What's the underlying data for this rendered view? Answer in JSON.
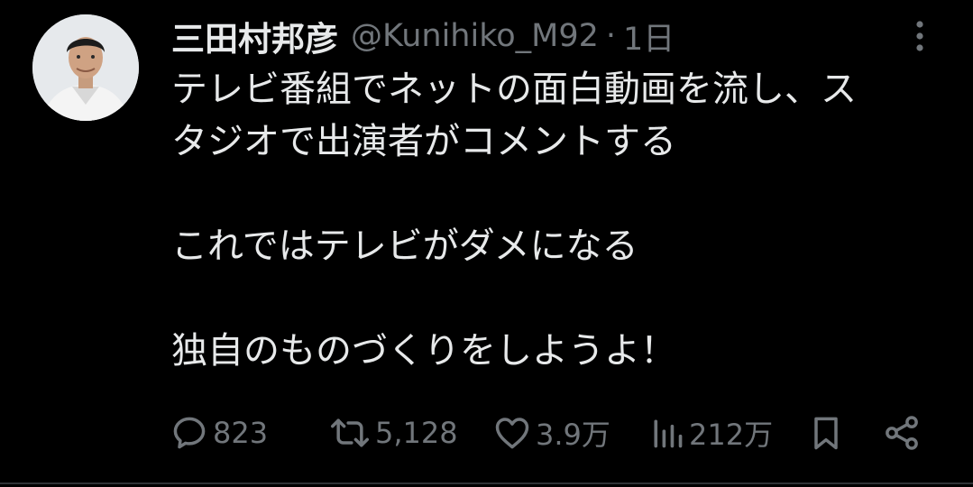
{
  "author": {
    "display_name": "三田村邦彦",
    "handle": "@Kunihiko_M92",
    "separator": "·",
    "timestamp": "1日"
  },
  "tweet": {
    "lines": [
      "テレビ番組でネットの面白動画を流し、ス",
      "タジオで出演者がコメントする",
      "",
      "これではテレビがダメになる",
      "",
      "独自のものづくりをしようよ！"
    ]
  },
  "actions": {
    "replies": "823",
    "retweets": "5,128",
    "likes": "3.9万",
    "views": "212万"
  },
  "icons": {
    "reply": "reply-icon",
    "retweet": "retweet-icon",
    "like": "heart-icon",
    "views": "views-bar-icon",
    "bookmark": "bookmark-icon",
    "share": "share-icon",
    "more": "more-vertical-icon"
  },
  "colors": {
    "background": "#000000",
    "text": "#e7e9ea",
    "secondary": "#71767b"
  }
}
